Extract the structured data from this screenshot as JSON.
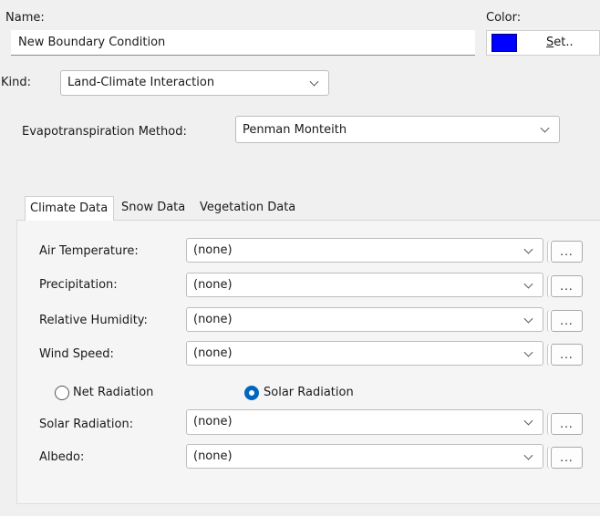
{
  "name_label": "Name:",
  "name_value": "New Boundary Condition",
  "color_label": "Color:",
  "color": {
    "swatch_hex": "#0000ff",
    "set_label_underlined": "S",
    "set_label_rest": "et.."
  },
  "kind_label": "Kind:",
  "kind_value": "Land-Climate Interaction",
  "evapo_label": "Evapotranspiration Method:",
  "evapo_value": "Penman Monteith",
  "tabs": [
    {
      "label": "Climate Data",
      "active": true
    },
    {
      "label": "Snow Data",
      "active": false
    },
    {
      "label": "Vegetation Data",
      "active": false
    }
  ],
  "fields": [
    {
      "label": "Air Temperature:",
      "value": "(none)",
      "button": "..."
    },
    {
      "label": "Precipitation:",
      "value": "(none)",
      "button": "..."
    },
    {
      "label": "Relative Humidity:",
      "value": "(none)",
      "button": "..."
    },
    {
      "label": "Wind Speed:",
      "value": "(none)",
      "button": "..."
    },
    {
      "label": "Solar Radiation:",
      "value": "(none)",
      "button": "..."
    },
    {
      "label": "Albedo:",
      "value": "(none)",
      "button": "..."
    }
  ],
  "radiation_options": [
    {
      "label": "Net Radiation",
      "selected": false
    },
    {
      "label": "Solar Radiation",
      "selected": true
    }
  ],
  "icons": {
    "dropdown": "chevron-down-icon",
    "radio": "radio-icon"
  },
  "accent_hex": "#0067c0"
}
